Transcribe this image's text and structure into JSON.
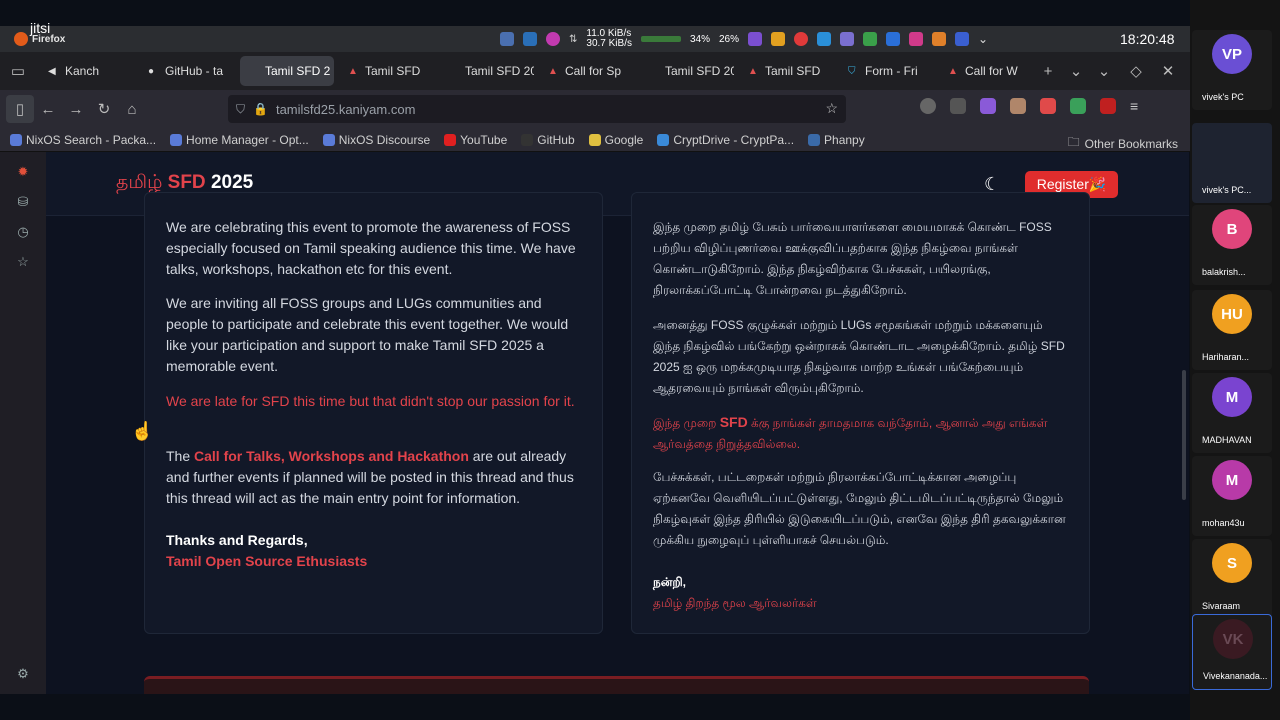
{
  "system": {
    "jitsi_label": "jitsi",
    "app_label": "Firefox",
    "net_up": "11.0 KiB/s",
    "net_down": "30.7 KiB/s",
    "cpu": "34%",
    "mem": "26%",
    "clock": "18:20:48"
  },
  "tabs": [
    {
      "label": "Kanch",
      "icon": "speaker"
    },
    {
      "label": "GitHub - ta",
      "icon": "github"
    },
    {
      "label": "Tamil SFD 2",
      "icon": "page",
      "active": true
    },
    {
      "label": "Tamil SFD",
      "icon": "sfd"
    },
    {
      "label": "Tamil SFD 202",
      "icon": "page"
    },
    {
      "label": "Call for Sp",
      "icon": "sfd"
    },
    {
      "label": "Tamil SFD 202",
      "icon": "page"
    },
    {
      "label": "Tamil SFD",
      "icon": "sfd"
    },
    {
      "label": "Form - Fri",
      "icon": "shield"
    },
    {
      "label": "Call for W",
      "icon": "sfd"
    }
  ],
  "url": "tamilsfd25.kaniyam.com",
  "bookmarks": [
    "NixOS Search - Packa...",
    "Home Manager - Opt...",
    "NixOS Discourse",
    "YouTube",
    "GitHub",
    "Google",
    "CryptDrive - CryptPa...",
    "Phanpy"
  ],
  "other_bookmarks": "Other Bookmarks",
  "site": {
    "logo_tamil": "தமிழ்",
    "logo_sfd": "SFD",
    "logo_year": "2025",
    "register": "Register🎉"
  },
  "english": {
    "p1": "We are celebrating this event to promote the awareness of FOSS especially focused on Tamil speaking audience this time. We have talks, workshops, hackathon etc for this event.",
    "p2": "We are inviting all FOSS groups and LUGs communities and people to participate and celebrate this event together. We would like your participation and support to make Tamil SFD 2025 a memorable event.",
    "p3": "We are late for SFD this time but that didn't stop our passion for it.",
    "p4_pre": "The ",
    "p4_link": "Call for Talks, Workshops and Hackathon",
    "p4_post": " are out already and further events if planned will be posted in this thread and thus this thread will act as the main entry point for information.",
    "thanks": "Thanks and Regards,",
    "sign": "Tamil Open Source Ethusiasts"
  },
  "tamil": {
    "p1": "இந்த முறை தமிழ் பேசும் பார்வையாளர்களை மையமாகக் கொண்ட FOSS பற்றிய விழிப்புணர்வை ஊக்குவிப்பதற்காக இந்த நிகழ்வை நாங்கள் கொண்டாடுகிறோம். இந்த நிகழ்விற்காக பேச்சுகள், பயிலரங்கு, நிரலாக்கப்போட்டி போன்றவை நடத்துகிறோம்.",
    "p2": "அனைத்து FOSS குழுக்கள் மற்றும் LUGs சமூகங்கள் மற்றும் மக்களையும் இந்த நிகழ்வில் பங்கேற்று ஒன்றாகக் கொண்டாட அழைக்கிறோம். தமிழ் SFD 2025 ஐ ஒரு மறக்கமுடியாத நிகழ்வாக மாற்ற உங்கள் பங்கேற்பையும் ஆதரவையும் நாங்கள் விரும்புகிறோம்.",
    "p3_pre": "இந்த முறை ",
    "p3_sfd": "SFD",
    "p3_post": " க்கு நாங்கள் தாமதமாக வந்தோம், ஆனால் அது எங்கள் ஆர்வத்தை நிறுத்தவில்லை.",
    "p4": "பேச்சுக்கள், பட்டறைகள் மற்றும் நிரலாக்கப்போட்டிக்கான அழைப்பு ஏற்கனவே வெளியிடப்பட்டுள்ளது, மேலும் திட்டமிடப்பட்டிருந்தால் மேலும் நிகழ்வுகள் இந்த திரியில் இடுகையிடப்படும், எனவே இந்த திரி தகவலுக்கான முக்கிய நுழைவுப் புள்ளியாகச் செயல்படும்.",
    "thanks": "நன்றி,",
    "sign": "தமிழ் திறந்த மூல ஆர்வலர்கள்"
  },
  "participants": [
    {
      "initials": "VP",
      "name": "vivek's PC",
      "color": "#6a4fd4"
    },
    {
      "initials": "",
      "name": "vivek's PC...",
      "color": "#222"
    },
    {
      "initials": "B",
      "name": "balakrish...",
      "color": "#e0457b"
    },
    {
      "initials": "HU",
      "name": "Hariharan...",
      "color": "#f0a020"
    },
    {
      "initials": "M",
      "name": "MADHAVAN",
      "color": "#7a44d0"
    },
    {
      "initials": "M",
      "name": "mohan43u",
      "color": "#b83aa8"
    },
    {
      "initials": "S",
      "name": "Sivaraam",
      "color": "#f0a020"
    },
    {
      "initials": "VK",
      "name": "Vivekananada...",
      "color": "#3a1a22"
    }
  ]
}
